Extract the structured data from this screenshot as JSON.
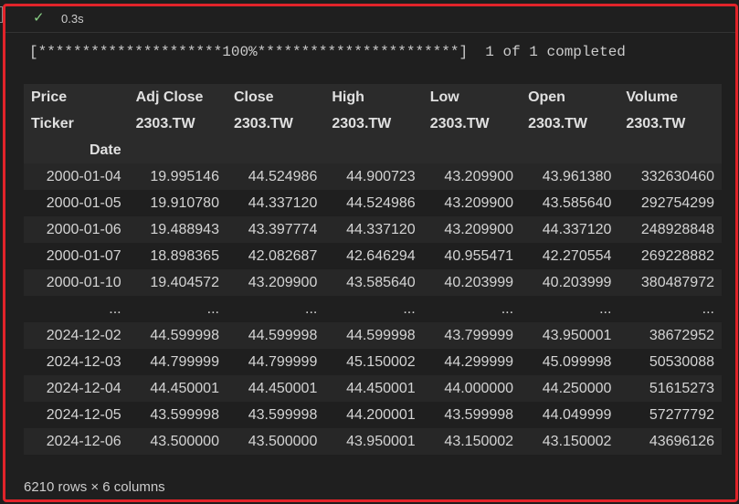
{
  "cell": {
    "status_icon": "check-icon",
    "status_check": "✓",
    "exec_time": "0.3s"
  },
  "output": {
    "progress_line": "[*********************100%***********************]  1 of 1 completed"
  },
  "dataframe": {
    "header_row_1": [
      "Price",
      "Adj Close",
      "Close",
      "High",
      "Low",
      "Open",
      "Volume"
    ],
    "header_row_2": [
      "Ticker",
      "2303.TW",
      "2303.TW",
      "2303.TW",
      "2303.TW",
      "2303.TW",
      "2303.TW"
    ],
    "index_name": "Date",
    "rows": [
      [
        "2000-01-04",
        "19.995146",
        "44.524986",
        "44.900723",
        "43.209900",
        "43.961380",
        "332630460"
      ],
      [
        "2000-01-05",
        "19.910780",
        "44.337120",
        "44.524986",
        "43.209900",
        "43.585640",
        "292754299"
      ],
      [
        "2000-01-06",
        "19.488943",
        "43.397774",
        "44.337120",
        "43.209900",
        "44.337120",
        "248928848"
      ],
      [
        "2000-01-07",
        "18.898365",
        "42.082687",
        "42.646294",
        "40.955471",
        "42.270554",
        "269228882"
      ],
      [
        "2000-01-10",
        "19.404572",
        "43.209900",
        "43.585640",
        "40.203999",
        "40.203999",
        "380487972"
      ],
      [
        "...",
        "...",
        "...",
        "...",
        "...",
        "...",
        "..."
      ],
      [
        "2024-12-02",
        "44.599998",
        "44.599998",
        "44.599998",
        "43.799999",
        "43.950001",
        "38672952"
      ],
      [
        "2024-12-03",
        "44.799999",
        "44.799999",
        "45.150002",
        "44.299999",
        "45.099998",
        "50530088"
      ],
      [
        "2024-12-04",
        "44.450001",
        "44.450001",
        "44.450001",
        "44.000000",
        "44.250000",
        "51615273"
      ],
      [
        "2024-12-05",
        "43.599998",
        "43.599998",
        "44.200001",
        "43.599998",
        "44.049999",
        "57277792"
      ],
      [
        "2024-12-06",
        "43.500000",
        "43.500000",
        "43.950001",
        "43.150002",
        "43.150002",
        "43696126"
      ]
    ],
    "shape_text": "6210 rows × 6 columns"
  },
  "colors": {
    "highlight_border": "#e1242a",
    "success": "#89d185",
    "background": "#1f1f1f"
  }
}
